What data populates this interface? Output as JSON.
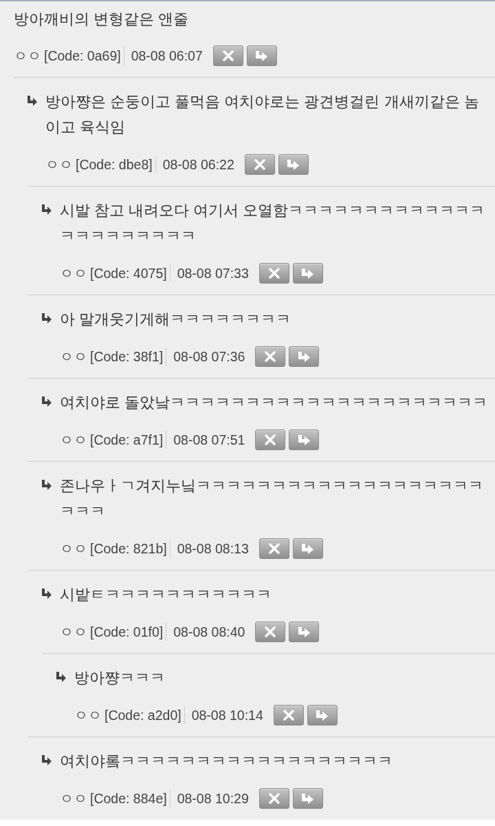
{
  "post": {
    "text": "방아깨비의 변형같은 앤줄",
    "author": "ㅇㅇ",
    "code": "[Code: 0a69]",
    "time": "08-08 06:07"
  },
  "comments": [
    {
      "text": "방아쨩은 순둥이고 풀먹음 여치야로는 광견병걸린 개새끼같은 놈이고 육식임",
      "author": "ㅇㅇ",
      "code": "[Code: dbe8]",
      "time": "08-08 06:22",
      "children": [
        {
          "text": "시발 참고 내려오다 여기서 오열함ㅋㅋㅋㅋㅋㅋㅋㅋㅋㅋㅋㅋㅋㅋㅋㅋㅋㅋㅋㅋㅋㅋ",
          "author": "ㅇㅇ",
          "code": "[Code: 4075]",
          "time": "08-08 07:33"
        },
        {
          "text": "아 말개웃기게해ㅋㅋㅋㅋㅋㅋㅋㅋ",
          "author": "ㅇㅇ",
          "code": "[Code: 38f1]",
          "time": "08-08 07:36"
        },
        {
          "text": "여치야로 돌았낰ㅋㅋㅋㅋㅋㅋㅋㅋㅋㅋㅋㅋㅋㅋㅋㅋㅋㅋㅋㅋㅋ",
          "author": "ㅇㅇ",
          "code": "[Code: a7f1]",
          "time": "08-08 07:51"
        },
        {
          "text": "존나우ㅏㄱ겨지누닠ㅋㅋㅋㅋㅋㅋㅋㅋㅋㅋㅋㅋㅋㅋㅋㅋㅋㅋㅋㅋㅋㅋ",
          "author": "ㅇㅇ",
          "code": "[Code: 821b]",
          "time": "08-08 08:13"
        },
        {
          "text": "시밭ㅌㅋㅋㅋㅋㅋㅋㅋㅋㅋㅋㅋ",
          "author": "ㅇㅇ",
          "code": "[Code: 01f0]",
          "time": "08-08 08:40",
          "children": [
            {
              "text": "방아쨩ㅋㅋㅋ",
              "author": "ㅇㅇ",
              "code": "[Code: a2d0]",
              "time": "08-08 10:14"
            }
          ]
        },
        {
          "text": "여치야롴ㅋㅋㅋㅋㅋㅋㅋㅋㅋㅋㅋㅋㅋㅋㅋㅋㅋㅋ",
          "author": "ㅇㅇ",
          "code": "[Code: 884e]",
          "time": "08-08 10:29"
        }
      ]
    }
  ]
}
